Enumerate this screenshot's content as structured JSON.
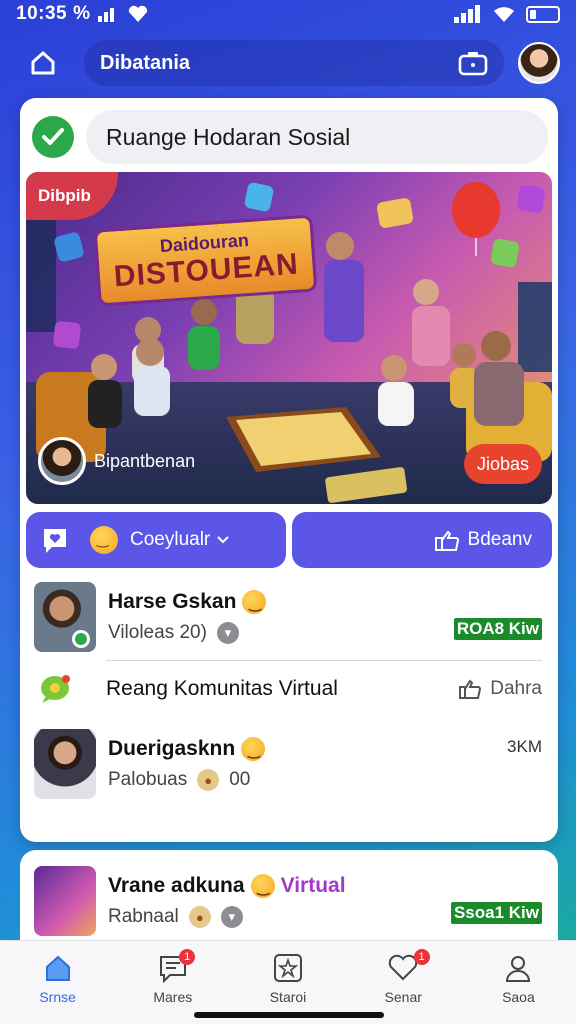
{
  "status_bar": {
    "time": "10:35",
    "extra": "%"
  },
  "header": {
    "title": "Dibatania"
  },
  "topic": {
    "title": "Ruange Hodaran Sosial"
  },
  "hero": {
    "badge": "Dibpib",
    "title_line1": "Daidouran",
    "title_line2": "DISTOUEAN",
    "username": "Bipantbenan",
    "action_label": "Jiobas"
  },
  "actions": {
    "left_label": "Coeylualr",
    "right_label": "Bdeanv"
  },
  "list": [
    {
      "name": "Harse Gskan",
      "sub": "Viloleas 20)",
      "meta": "ROA8 Kiw"
    },
    {
      "name": "Duerigasknn",
      "sub": "Palobuas",
      "sub_extra": "00",
      "meta": "3KM"
    }
  ],
  "community": {
    "label": "Reang Komunitas Virtual",
    "share_label": "Dahra"
  },
  "second": {
    "name": "Vrane adkuna",
    "highlight": "Virtual",
    "sub": "Rabnaal",
    "meta": "Ssoa1 Kiw"
  },
  "nav": [
    {
      "label": "Srnse",
      "badge": ""
    },
    {
      "label": "Mares",
      "badge": "1"
    },
    {
      "label": "Staroi",
      "badge": ""
    },
    {
      "label": "Senar",
      "badge": "1"
    },
    {
      "label": "Saoa",
      "badge": ""
    }
  ]
}
